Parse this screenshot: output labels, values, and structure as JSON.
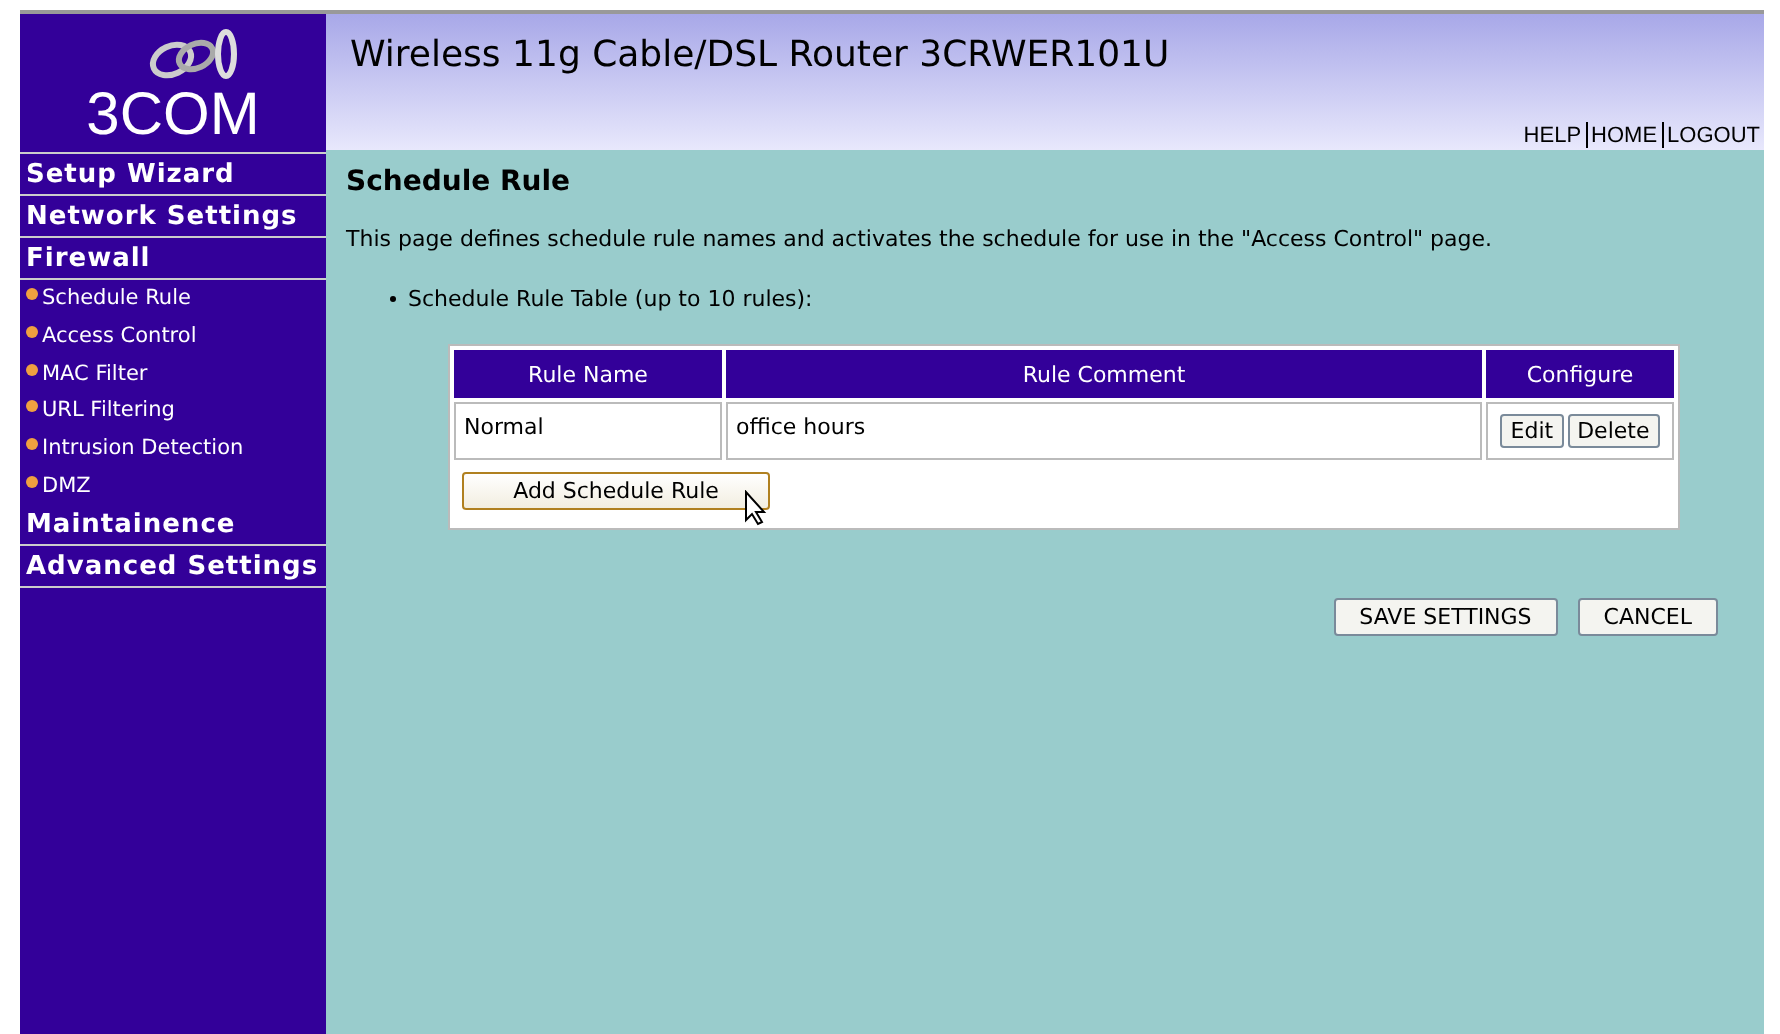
{
  "logo": {
    "text": "3COM"
  },
  "header": {
    "title": "Wireless 11g Cable/DSL Router 3CRWER101U",
    "links": [
      "HELP",
      "HOME",
      "LOGOUT"
    ]
  },
  "sidebar": {
    "items": [
      {
        "kind": "section",
        "label": "Setup Wizard"
      },
      {
        "kind": "section",
        "label": "Network Settings"
      },
      {
        "kind": "section",
        "label": "Firewall"
      },
      {
        "kind": "sub",
        "label": "Schedule Rule"
      },
      {
        "kind": "sub",
        "label": "Access Control"
      },
      {
        "kind": "sub",
        "label": "MAC Filter"
      },
      {
        "kind": "sub",
        "label": "URL Filtering"
      },
      {
        "kind": "sub",
        "label": "Intrusion Detection"
      },
      {
        "kind": "sub",
        "label": "DMZ"
      },
      {
        "kind": "section",
        "label": "Maintainence"
      },
      {
        "kind": "section",
        "label": "Advanced Settings"
      }
    ]
  },
  "page": {
    "heading": "Schedule Rule",
    "description": "This page defines schedule rule names and activates the schedule for use in the \"Access Control\" page.",
    "bullet": "Schedule Rule Table (up to 10 rules):"
  },
  "table": {
    "columns": [
      "Rule Name",
      "Rule Comment",
      "Configure"
    ],
    "rows": [
      {
        "name": "Normal",
        "comment": "office hours",
        "actions": [
          "Edit",
          "Delete"
        ]
      }
    ],
    "add_button": "Add Schedule Rule"
  },
  "buttons": [
    "SAVE SETTINGS",
    "CANCEL"
  ]
}
